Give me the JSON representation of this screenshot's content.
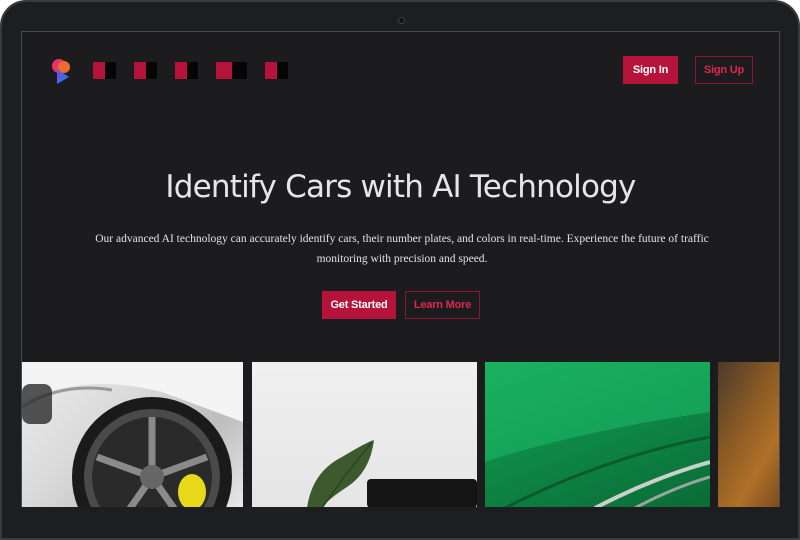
{
  "nav": {
    "logo_icon": "app-logo-icon",
    "link_count_note": "",
    "signin_label": "Sign In",
    "signup_label": "Sign Up"
  },
  "hero": {
    "title": "Identify Cars with AI Technology",
    "description": "Our advanced AI technology can accurately identify cars, their number plates, and colors in real-time. Experience the future of traffic monitoring with precision and speed.",
    "primary_button": "Get Started",
    "secondary_button": "Learn More"
  },
  "gallery": {
    "images": [
      "white-car-wheel-photo",
      "plant-and-laptop-photo",
      "green-car-hood-photo",
      "brown-sweater-photo"
    ]
  },
  "colors": {
    "accent": "#b5133a",
    "background": "#1c1c1e",
    "text": "#e6e6e6"
  }
}
